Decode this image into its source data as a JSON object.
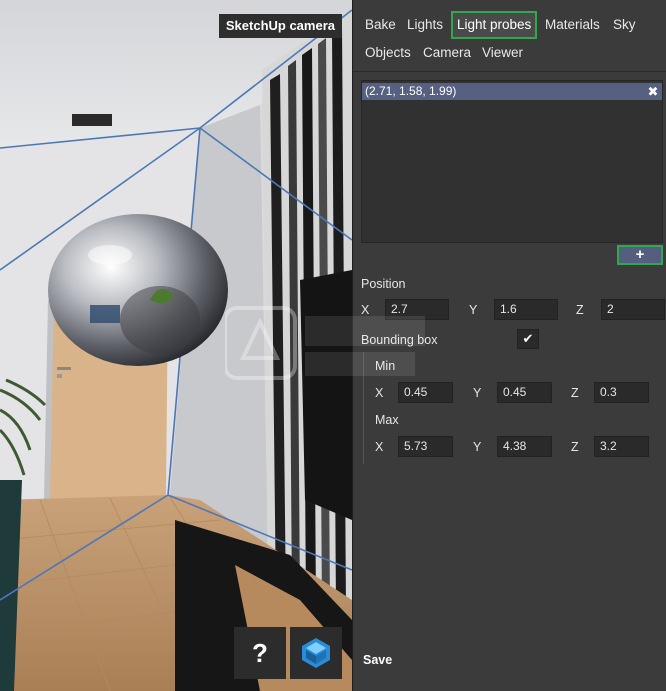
{
  "viewport": {
    "camera_label": "SketchUp camera",
    "help_label": "?",
    "logo_icon": "shapespark-logo-icon"
  },
  "tabs": [
    {
      "label": "Bake"
    },
    {
      "label": "Lights"
    },
    {
      "label": "Light probes",
      "active": true
    },
    {
      "label": "Materials"
    },
    {
      "label": "Sky"
    },
    {
      "label": "Objects"
    },
    {
      "label": "Camera"
    },
    {
      "label": "Viewer"
    }
  ],
  "probes": {
    "items": [
      {
        "label": "(2.71, 1.58, 1.99)"
      }
    ],
    "remove_icon": "close-icon",
    "add_label": "+"
  },
  "position": {
    "label": "Position",
    "x_label": "X",
    "x": "2.7",
    "y_label": "Y",
    "y": "1.6",
    "z_label": "Z",
    "z": "2"
  },
  "bounding_box": {
    "label": "Bounding box",
    "checked": true,
    "check_glyph": "✔",
    "min": {
      "label": "Min",
      "x_label": "X",
      "x": "0.45",
      "y_label": "Y",
      "y": "0.45",
      "z_label": "Z",
      "z": "0.3"
    },
    "max": {
      "label": "Max",
      "x_label": "X",
      "x": "5.73",
      "y_label": "Y",
      "y": "4.38",
      "z_label": "Z",
      "z": "3.2"
    }
  },
  "save_label": "Save",
  "colors": {
    "panel_bg": "#3b3b3b",
    "selection": "#566080",
    "active_outline": "#2fa84f",
    "input_bg": "#2a2a2a"
  }
}
